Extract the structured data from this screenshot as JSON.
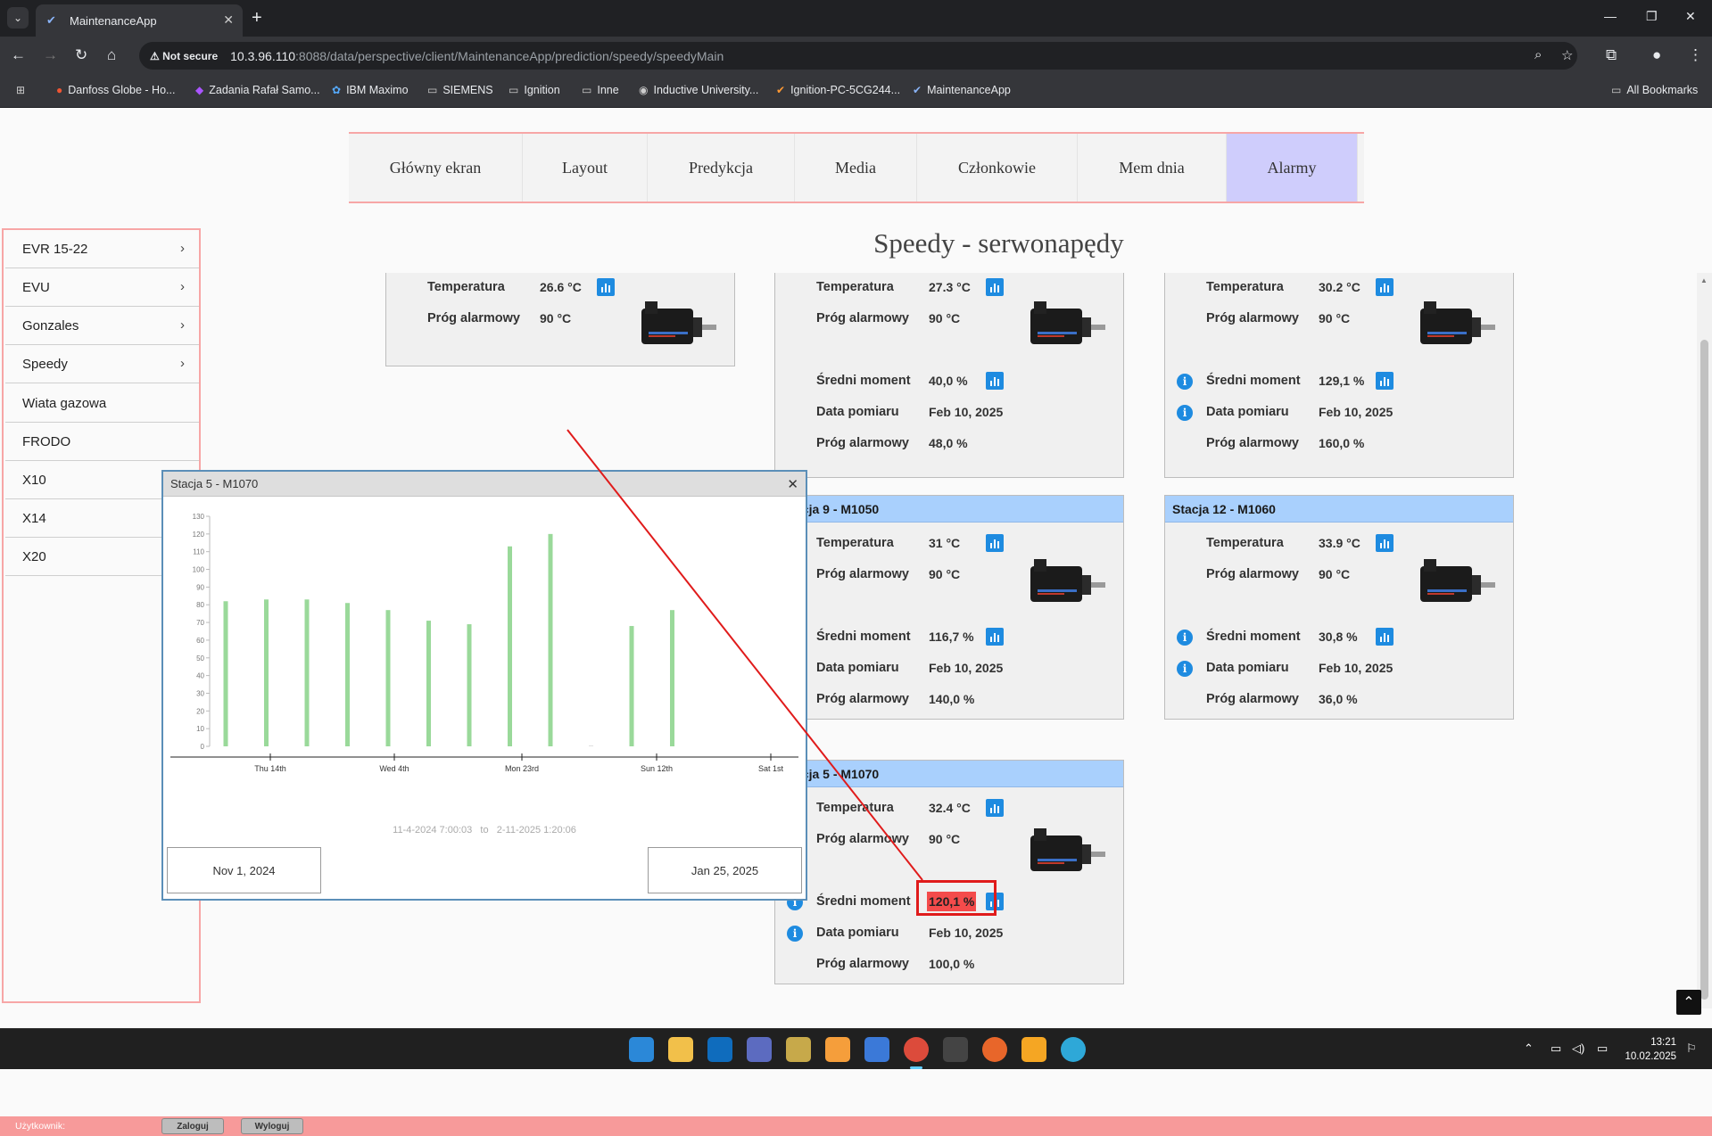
{
  "browser": {
    "tab_title": "MaintenanceApp",
    "not_secure": "Not secure",
    "url_host": "10.3.96.110",
    "url_path": ":8088/data/perspective/client/MaintenanceApp/prediction/speedy/speedyMain",
    "bookmarks": [
      "Danfoss Globe - Ho...",
      "Zadania Rafał Samo...",
      "IBM Maximo",
      "SIEMENS",
      "Ignition",
      "Inne",
      "Inductive University...",
      "Ignition-PC-5CG244...",
      "MaintenanceApp"
    ],
    "all_bookmarks": "All Bookmarks"
  },
  "topnav": {
    "items": [
      "Główny ekran",
      "Layout",
      "Predykcja",
      "Media",
      "Członkowie",
      "Mem dnia",
      "Alarmy"
    ]
  },
  "page_title": "Speedy - serwonapędy",
  "sidebar": {
    "items": [
      "EVR 15-22",
      "EVU",
      "Gonzales",
      "Speedy",
      "Wiata gazowa",
      "FRODO",
      "X10",
      "X14",
      "X20"
    ]
  },
  "labels": {
    "temperatura": "Temperatura",
    "prog": "Próg alarmowy",
    "moment": "Średni moment",
    "data": "Data pomiaru"
  },
  "cards": {
    "c1": {
      "temp": "26.6 °C",
      "temp_alarm": "90 °C"
    },
    "c2": {
      "temp": "27.3 °C",
      "temp_alarm": "90 °C",
      "moment": "40,0 %",
      "date": "Feb 10, 2025",
      "moment_alarm": "48,0 %"
    },
    "c3": {
      "temp": "30.2 °C",
      "temp_alarm": "90 °C",
      "moment": "129,1 %",
      "date": "Feb 10, 2025",
      "moment_alarm": "160,0 %"
    },
    "c4": {
      "title": "Stacja 9 - M1050",
      "temp": "31 °C",
      "temp_alarm": "90 °C",
      "moment": "116,7 %",
      "date": "Feb 10, 2025",
      "moment_alarm": "140,0 %"
    },
    "c5": {
      "title": "Stacja 12 - M1060",
      "temp": "33.9 °C",
      "temp_alarm": "90 °C",
      "moment": "30,8 %",
      "date": "Feb 10, 2025",
      "moment_alarm": "36,0 %"
    },
    "c6": {
      "title": "Stacja 5 - M1070",
      "temp": "32.4 °C",
      "temp_alarm": "90 °C",
      "moment": "120,1 %",
      "date": "Feb 10, 2025",
      "moment_alarm": "100,0 %"
    }
  },
  "popup": {
    "title": "Stacja 5 - M1070",
    "range_start": "11-4-2024   7:00:03",
    "range_to": "to",
    "range_end": "2-11-2025   1:20:06",
    "date_from": "Nov 1, 2024",
    "date_to": "Jan 25, 2025"
  },
  "chart_data": {
    "type": "bar",
    "x_ticks": [
      "Thu 14th",
      "Wed 4th",
      "Mon 23rd",
      "Sun 12th",
      "Sat 1st"
    ],
    "y_ticks": [
      0,
      10,
      20,
      30,
      40,
      50,
      60,
      70,
      80,
      90,
      100,
      110,
      120,
      130
    ],
    "ylim": [
      0,
      130
    ],
    "values": [
      82,
      83,
      83,
      81,
      77,
      71,
      69,
      113,
      120,
      0,
      68,
      77
    ],
    "bar_color": "#9ad99a"
  },
  "footer": {
    "user_label": "Użytkownik:",
    "login": "Zaloguj",
    "logout": "Wyloguj"
  },
  "taskbar": {
    "time": "13:21",
    "date": "10.02.2025"
  }
}
